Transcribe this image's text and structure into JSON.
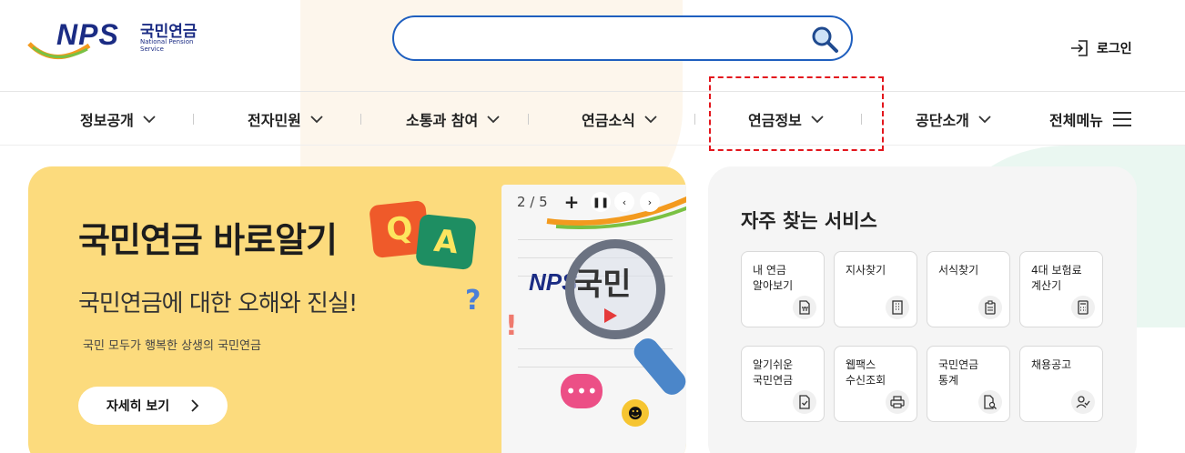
{
  "header": {
    "logo_nps": "NPS",
    "logo_kr": "국민연금",
    "logo_en": "National Pension Service",
    "search": {
      "value": "",
      "placeholder": ""
    },
    "login_label": "로그인"
  },
  "nav": {
    "items": [
      {
        "label": "정보공개"
      },
      {
        "label": "전자민원"
      },
      {
        "label": "소통과 참여"
      },
      {
        "label": "연금소식"
      },
      {
        "label": "연금정보"
      },
      {
        "label": "공단소개"
      }
    ],
    "all_menu_label": "전체메뉴"
  },
  "banner": {
    "title_a": "국민연금",
    "title_b": "바로알기",
    "qa_q": "Q",
    "qa_a": "A",
    "subtitle": "국민연금에 대한 오해와 진실!",
    "description": "국민 모두가 행복한 상생의 국민연금",
    "detail_button": "자세히 보기",
    "counter": "2 / 5",
    "card_nps": "NPS",
    "card_lens_text": "국민"
  },
  "services": {
    "title": "자주 찾는 서비스",
    "tiles": [
      {
        "label": "내 연금\n알아보기",
        "icon": "won-document-icon"
      },
      {
        "label": "지사찾기",
        "icon": "building-icon"
      },
      {
        "label": "서식찾기",
        "icon": "clipboard-icon"
      },
      {
        "label": "4대 보험료\n계산기",
        "icon": "calculator-icon"
      },
      {
        "label": "알기쉬운\n국민연금",
        "icon": "document-check-icon"
      },
      {
        "label": "웹팩스\n수신조회",
        "icon": "printer-icon"
      },
      {
        "label": "국민연금\n통계",
        "icon": "document-search-icon"
      },
      {
        "label": "채용공고",
        "icon": "person-check-icon"
      }
    ]
  },
  "colors": {
    "brand_navy": "#1b2c84",
    "search_border": "#1f5fbf",
    "banner_bg": "#fcdb7d",
    "highlight": "#e3161d"
  }
}
